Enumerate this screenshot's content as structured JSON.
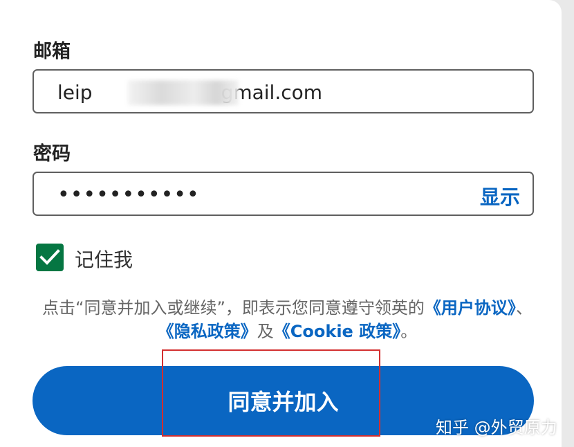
{
  "email": {
    "label": "邮箱",
    "value_prefix": "leip",
    "value_suffix": "gmail.com"
  },
  "password": {
    "label": "密码",
    "masked_value": "•••••••••••",
    "show_label": "显示"
  },
  "remember": {
    "label": "记住我",
    "checked": true
  },
  "legal": {
    "text_before": "点击“同意并加入或继续”，即表示您同意遵守领英的",
    "user_agreement": "《用户协议》",
    "separator": "、",
    "privacy_policy": "《隐私政策》",
    "conjunction": "及",
    "cookie_policy": "《Cookie 政策》",
    "end": "。"
  },
  "join_button": {
    "label": "同意并加入"
  },
  "watermark": {
    "text": "知乎 @外贸原力"
  },
  "colors": {
    "accent": "#0a66c2",
    "checkbox": "#057642",
    "highlight": "#d32f2f"
  },
  "icons": {
    "checkbox": "checkmark-icon"
  }
}
